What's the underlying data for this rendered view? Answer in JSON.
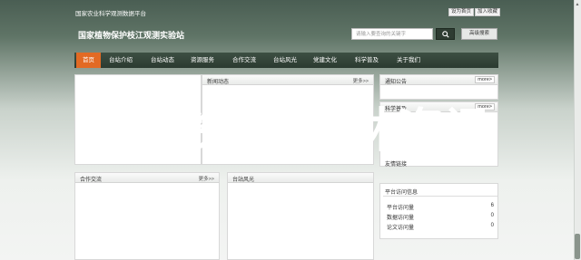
{
  "header": {
    "site_sub": "国家农业科学观测数据平台",
    "top_links": [
      "设为首页",
      "加入收藏"
    ],
    "site_title": "国家植物保护枝江观测实验站",
    "search_placeholder": "请输入要查询的关键字",
    "advanced_search": "高级搜索"
  },
  "nav": [
    "首页",
    "台站介绍",
    "台站动态",
    "资源服务",
    "合作交流",
    "台站风光",
    "党建文化",
    "科学普及",
    "关于我们"
  ],
  "panels": {
    "news": {
      "title": "新闻动态",
      "more": "更多>>"
    },
    "notice": {
      "title": "通知公告",
      "more": "more>"
    },
    "science": {
      "title": "科学普及",
      "more": "more>"
    },
    "exchange": {
      "title": "合作交流",
      "more": "更多>>"
    },
    "scenery": {
      "title": "台站风光"
    },
    "links": {
      "title": "友情链接"
    },
    "stats": {
      "title": "平台访问信息",
      "rows": [
        {
          "label": "平台访问量",
          "value": "6"
        },
        {
          "label": "数据访问量",
          "value": "0"
        },
        {
          "label": "论文访问量",
          "value": "0"
        }
      ]
    }
  },
  "overlay_text": "武林资讯,武林资讯"
}
